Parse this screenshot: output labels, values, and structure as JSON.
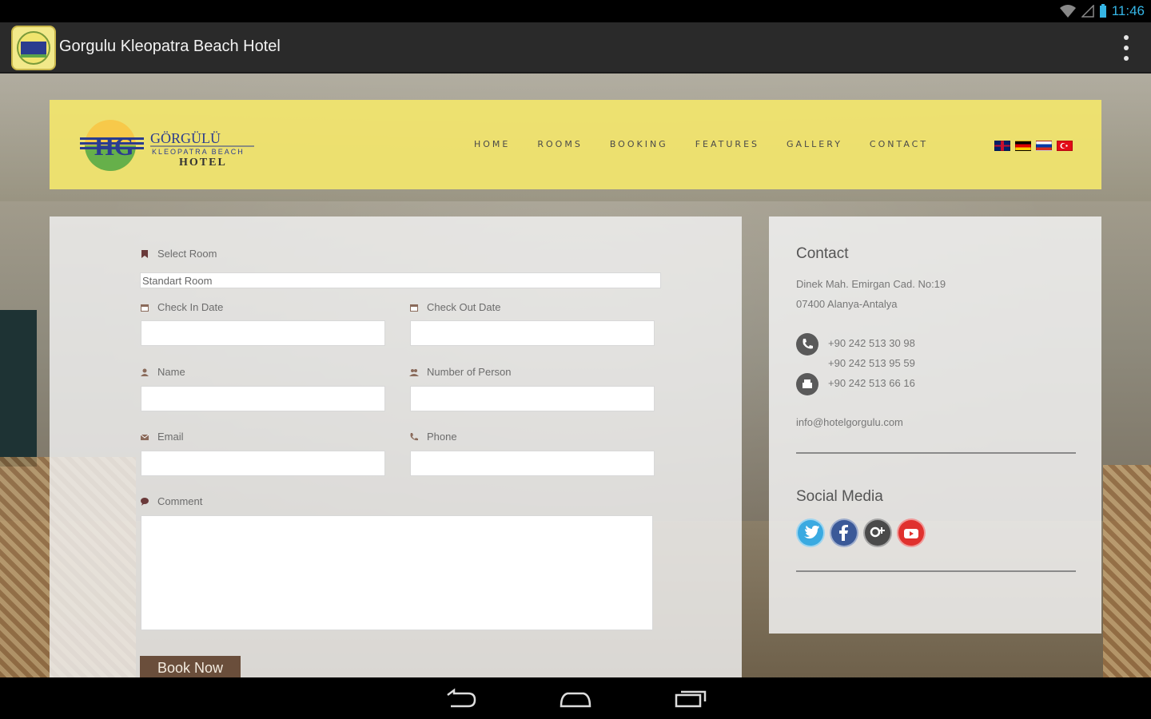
{
  "status_bar": {
    "time": "11:46"
  },
  "action_bar": {
    "title": "Gorgulu Kleopatra Beach Hotel"
  },
  "header": {
    "logo_text": {
      "brand": "GÖRGÜLÜ",
      "sub": "KLEOPATRA BEACH",
      "hotel": "HOTEL",
      "mark": "HG"
    },
    "nav": [
      "HOME",
      "ROOMS",
      "BOOKING",
      "FEATURES",
      "GALLERY",
      "CONTACT"
    ],
    "flags": [
      "uk-flag",
      "german-flag",
      "russian-flag",
      "turkish-flag"
    ]
  },
  "booking": {
    "select_room_label": "Select Room",
    "select_room_value": "Standart Room",
    "check_in_label": "Check In Date",
    "check_out_label": "Check Out Date",
    "name_label": "Name",
    "persons_label": "Number of Person",
    "email_label": "Email",
    "phone_label": "Phone",
    "comment_label": "Comment",
    "submit_label": "Book Now"
  },
  "contact": {
    "title": "Contact",
    "address_line1": "Dinek Mah. Emirgan Cad. No:19",
    "address_line2": "07400 Alanya-Antalya",
    "phone1": "+90 242 513 30 98",
    "phone2": "+90 242 513 95 59",
    "fax": "+90 242 513 66 16",
    "email": "info@hotelgorgulu.com",
    "social_title": "Social Media",
    "social": [
      "twitter",
      "facebook",
      "google-plus",
      "youtube"
    ]
  },
  "colors": {
    "header_yellow": "#f0e46e",
    "button_brown": "#6a4e3b",
    "twitter": "#3aaae1",
    "facebook": "#3b5998",
    "google_plus": "#4a4a4a",
    "youtube": "#e0312e"
  }
}
